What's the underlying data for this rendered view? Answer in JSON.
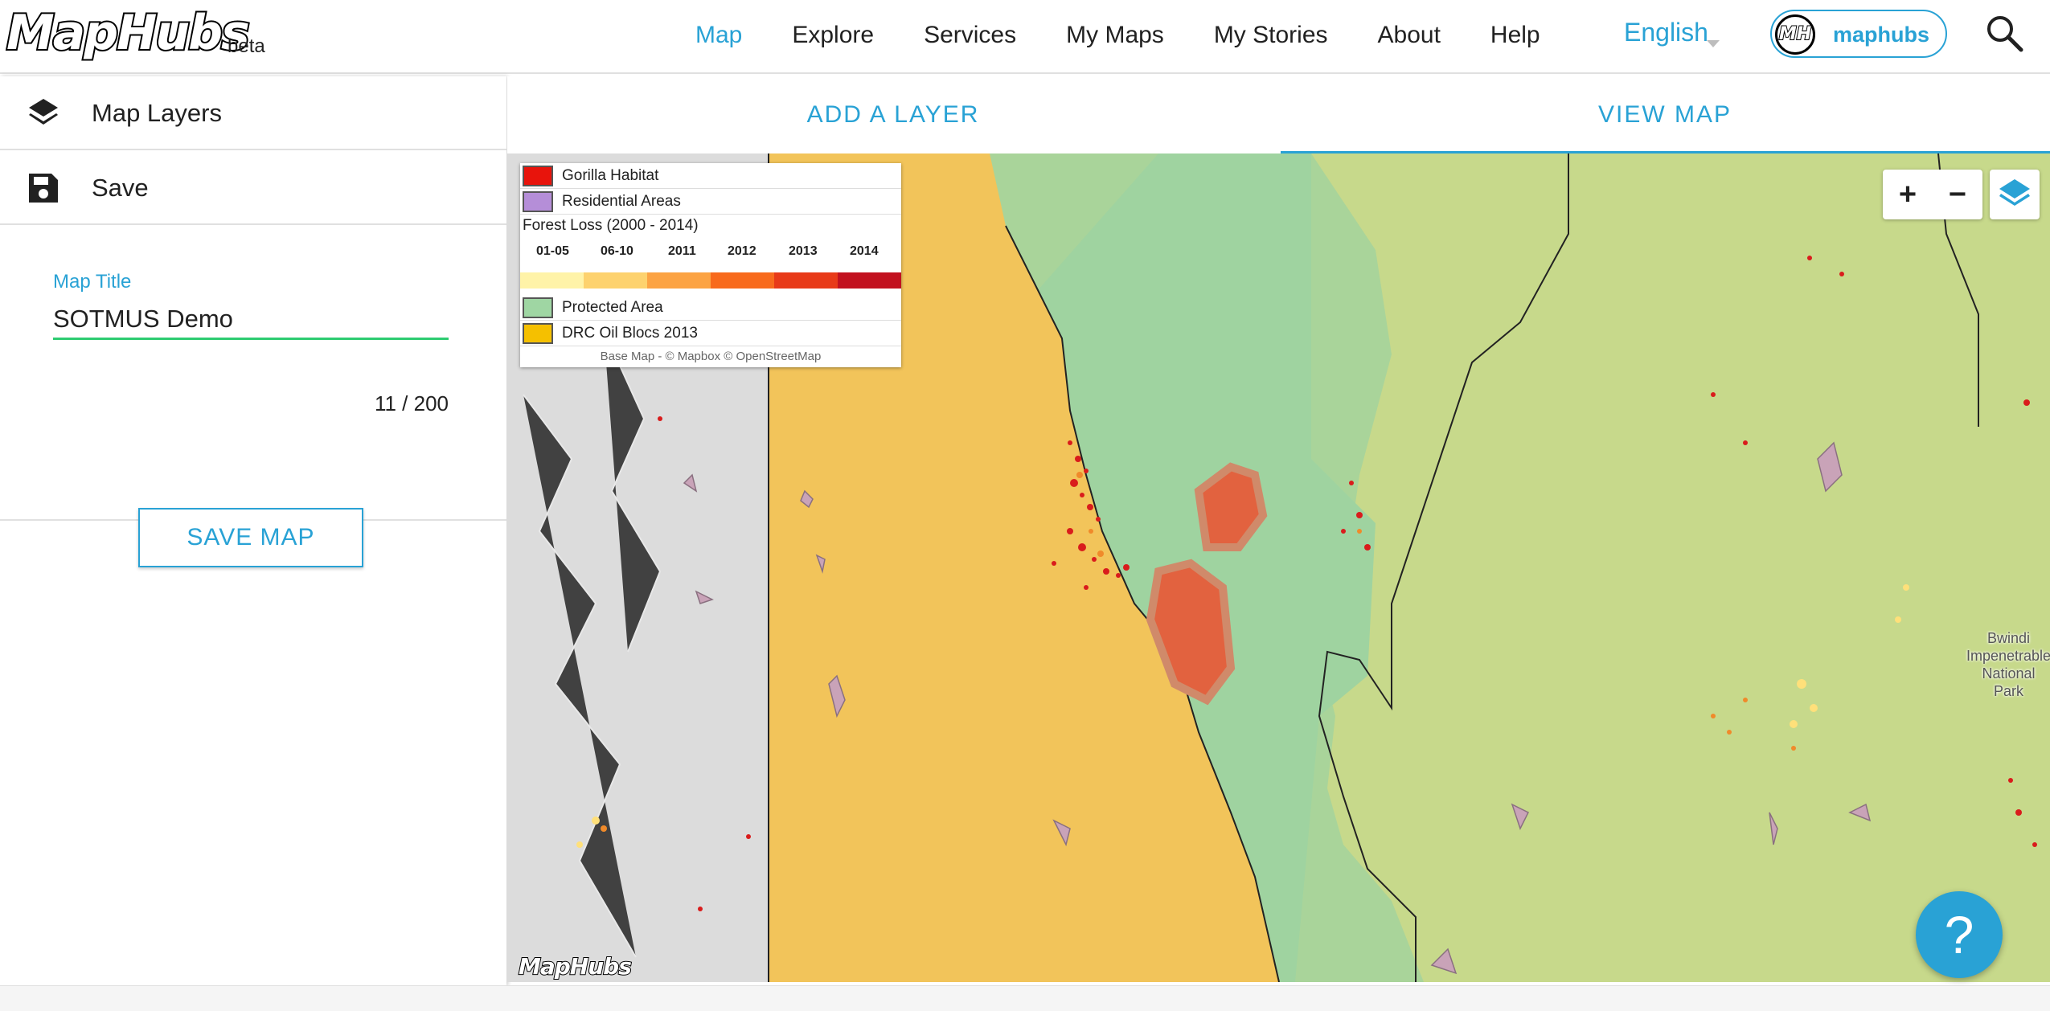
{
  "brand": {
    "logo_text": "MapHubs",
    "beta_label": "beta"
  },
  "nav": {
    "items": [
      {
        "label": "Map",
        "active": true
      },
      {
        "label": "Explore",
        "active": false
      },
      {
        "label": "Services",
        "active": false
      },
      {
        "label": "My Maps",
        "active": false
      },
      {
        "label": "My Stories",
        "active": false
      },
      {
        "label": "About",
        "active": false
      },
      {
        "label": "Help",
        "active": false
      }
    ],
    "language": "English",
    "user": {
      "avatar_initials": "MH",
      "name": "maphubs"
    },
    "search_icon": "search-icon"
  },
  "left_panel": {
    "map_layers_label": "Map Layers",
    "save_label": "Save",
    "map_title_label": "Map Title",
    "map_title_value": "SOTMUS Demo",
    "char_count": "11 / 200",
    "save_map_button": "SAVE MAP"
  },
  "tabs": {
    "add_layer": "ADD A LAYER",
    "view_map": "VIEW MAP",
    "active": "view_map"
  },
  "legend": {
    "gorilla": "Gorilla Habitat",
    "residential": "Residential Areas",
    "forest_loss_title": "Forest Loss (2000 - 2014)",
    "years": [
      "01-05",
      "06-10",
      "2011",
      "2012",
      "2013",
      "2014"
    ],
    "ramp_colors": [
      "#fff3a8",
      "#fdd26e",
      "#fca343",
      "#f86a1c",
      "#e83a18",
      "#c2111f"
    ],
    "protected": "Protected Area",
    "oil_blocs": "DRC Oil Blocs 2013",
    "attribution": "Base Map - © Mapbox © OpenStreetMap",
    "colors": {
      "gorilla": "#e8140c",
      "residential": "#b58ed8",
      "protected": "#9fd6a3",
      "oil_blocs": "#f5c000"
    }
  },
  "map": {
    "zoom_in": "+",
    "zoom_out": "−",
    "watermark": "MapHubs",
    "place_label": "Bwindi\nImpenetrable\nNational Park"
  },
  "help_button": "?",
  "colors": {
    "accent": "#29a2d5",
    "input_underline": "#2ecc71"
  }
}
